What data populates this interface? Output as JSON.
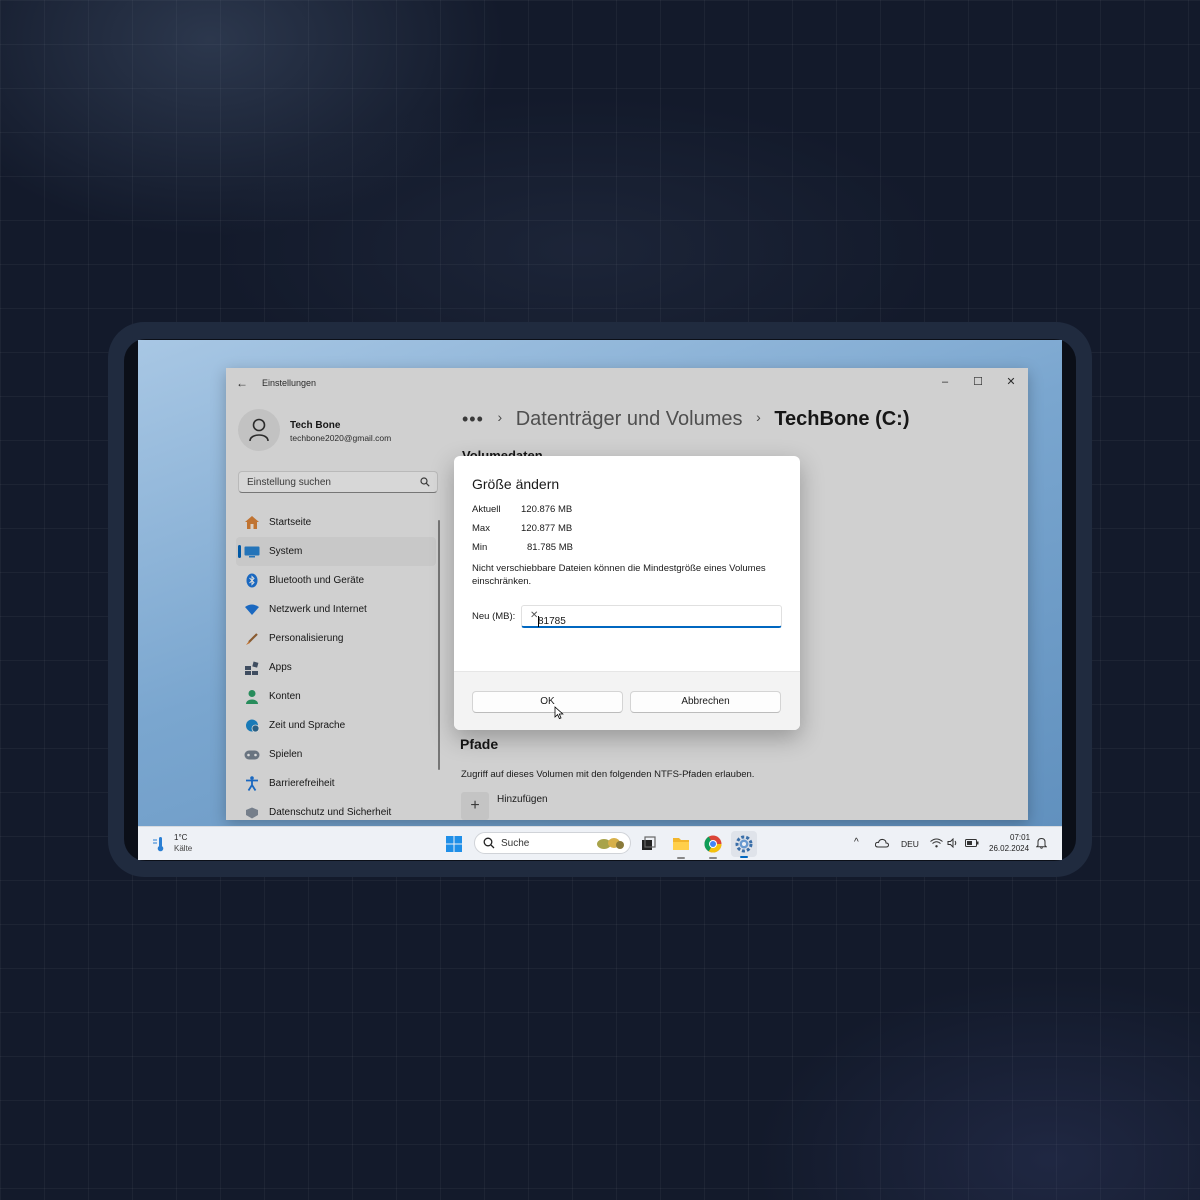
{
  "window": {
    "title": "Einstellungen",
    "controls": {
      "minimize": "–",
      "maximize": "☐",
      "close": "✕"
    }
  },
  "profile": {
    "name": "Tech Bone",
    "email": "techbone2020@gmail.com"
  },
  "search": {
    "placeholder": "Einstellung suchen"
  },
  "sidebar": {
    "items": [
      {
        "label": "Startseite",
        "icon": "home-icon"
      },
      {
        "label": "System",
        "icon": "system-icon",
        "active": true
      },
      {
        "label": "Bluetooth und Geräte",
        "icon": "bluetooth-icon"
      },
      {
        "label": "Netzwerk und Internet",
        "icon": "network-icon"
      },
      {
        "label": "Personalisierung",
        "icon": "brush-icon"
      },
      {
        "label": "Apps",
        "icon": "apps-icon"
      },
      {
        "label": "Konten",
        "icon": "account-icon"
      },
      {
        "label": "Zeit und Sprache",
        "icon": "globe-clock-icon"
      },
      {
        "label": "Spielen",
        "icon": "gamepad-icon"
      },
      {
        "label": "Barrierefreiheit",
        "icon": "accessibility-icon"
      },
      {
        "label": "Datenschutz und Sicherheit",
        "icon": "shield-icon"
      }
    ]
  },
  "breadcrumb": {
    "overflow": "•••",
    "parent": "Datenträger und Volumes",
    "separator": "›",
    "current": "TechBone (C:)"
  },
  "main": {
    "section_partial": "Volumedaten",
    "paths_title": "Pfade",
    "paths_desc": "Zugriff auf dieses Volumen mit den folgenden NTFS-Pfaden erlauben.",
    "add_icon": "+",
    "add_label": "Hinzufügen"
  },
  "dialog": {
    "title": "Größe ändern",
    "rows": [
      {
        "key": "Aktuell",
        "value": "120.876 MB"
      },
      {
        "key": "Max",
        "value": "120.877 MB"
      },
      {
        "key": "Min",
        "value": "81.785 MB"
      }
    ],
    "note": "Nicht verschiebbare Dateien können die Mindestgröße eines Volumes einschränken.",
    "input_label": "Neu (MB):",
    "input_value": "81785",
    "clear": "✕",
    "ok_label": "OK",
    "cancel_label": "Abbrechen"
  },
  "taskbar": {
    "weather_temp": "1°C",
    "weather_label": "Kälte",
    "search_label": "Suche",
    "apps": [
      "start-icon",
      "task-view-icon",
      "file-explorer-icon",
      "chrome-icon",
      "settings-icon"
    ],
    "tray": {
      "chevron": "^",
      "language": "DEU",
      "time": "07:01",
      "date": "26.02.2024"
    }
  },
  "colors": {
    "accent": "#0067c0",
    "page_bg": "#131a2b",
    "device_frame": "#202b3f"
  }
}
